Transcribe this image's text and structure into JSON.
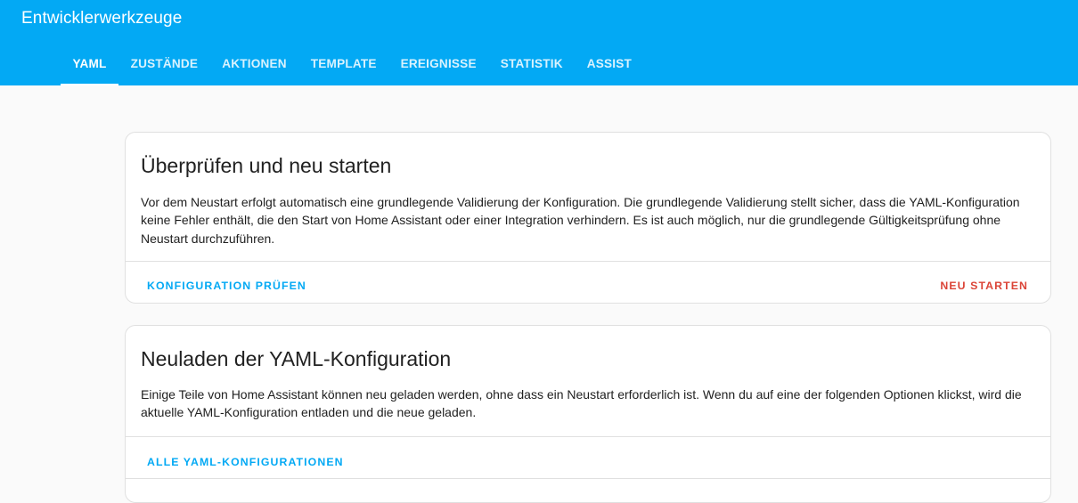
{
  "header": {
    "title": "Entwicklerwerkzeuge",
    "tabs": [
      {
        "label": "YAML",
        "active": true
      },
      {
        "label": "ZUSTÄNDE",
        "active": false
      },
      {
        "label": "AKTIONEN",
        "active": false
      },
      {
        "label": "TEMPLATE",
        "active": false
      },
      {
        "label": "EREIGNISSE",
        "active": false
      },
      {
        "label": "STATISTIK",
        "active": false
      },
      {
        "label": "ASSIST",
        "active": false
      }
    ]
  },
  "check_restart_card": {
    "title": "Überprüfen und neu starten",
    "description": "Vor dem Neustart erfolgt automatisch eine grundlegende Validierung der Konfiguration. Die grundlegende Validierung stellt sicher, dass die YAML-Konfiguration keine Fehler enthält, die den Start von Home Assistant oder einer Integration verhindern. Es ist auch möglich, nur die grundlegende Gültigkeitsprüfung ohne Neustart durchzuführen.",
    "check_button": "KONFIGURATION PRÜFEN",
    "restart_button": "NEU STARTEN"
  },
  "reload_card": {
    "title": "Neuladen der YAML-Konfiguration",
    "description": "Einige Teile von Home Assistant können neu geladen werden, ohne dass ein Neustart erforderlich ist. Wenn du auf eine der folgenden Optionen klickst, wird die aktuelle YAML-Konfiguration entladen und die neue geladen.",
    "reload_all_button": "ALLE YAML-KONFIGURATIONEN"
  },
  "colors": {
    "header_bg": "#03a9f4",
    "primary": "#03a9f4",
    "danger": "#db4437",
    "page_bg": "#fafafa"
  }
}
